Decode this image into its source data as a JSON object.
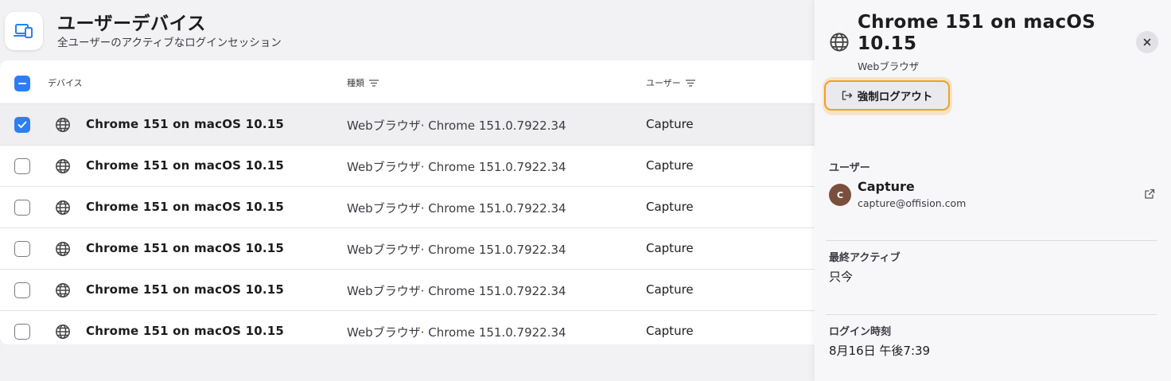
{
  "header": {
    "title": "ユーザーデバイス",
    "subtitle": "全ユーザーのアクティブなログインセッション",
    "icon": "devices-icon"
  },
  "table": {
    "columns": [
      "デバイス",
      "種類",
      "ユーザー"
    ],
    "rows": [
      {
        "name": "Chrome 151 on macOS 10.15",
        "type": "Webブラウザ· Chrome 151.0.7922.34",
        "user": "Capture",
        "checked": true
      },
      {
        "name": "Chrome 151 on macOS 10.15",
        "type": "Webブラウザ· Chrome 151.0.7922.34",
        "user": "Capture",
        "checked": false
      },
      {
        "name": "Chrome 151 on macOS 10.15",
        "type": "Webブラウザ· Chrome 151.0.7922.34",
        "user": "Capture",
        "checked": false
      },
      {
        "name": "Chrome 151 on macOS 10.15",
        "type": "Webブラウザ· Chrome 151.0.7922.34",
        "user": "Capture",
        "checked": false
      },
      {
        "name": "Chrome 151 on macOS 10.15",
        "type": "Webブラウザ· Chrome 151.0.7922.34",
        "user": "Capture",
        "checked": false
      },
      {
        "name": "Chrome 151 on macOS 10.15",
        "type": "Webブラウザ· Chrome 151.0.7922.34",
        "user": "Capture",
        "checked": false
      }
    ]
  },
  "panel": {
    "title": "Chrome 151 on macOS 10.15",
    "type": "Webブラウザ",
    "close_icon": "close-icon",
    "logout_label": "強制ログアウト",
    "user_section_label": "ユーザー",
    "user": {
      "initial": "C",
      "name": "Capture",
      "email": "capture@offision.com"
    },
    "last_active_label": "最終アクティブ",
    "last_active_value": "只今",
    "login_time_label": "ログイン時刻",
    "login_time_value": "8月16日 午後7:39"
  },
  "colors": {
    "accent": "#2b7ff3",
    "highlight": "#f0a020",
    "avatar": "#7b4f3d"
  }
}
